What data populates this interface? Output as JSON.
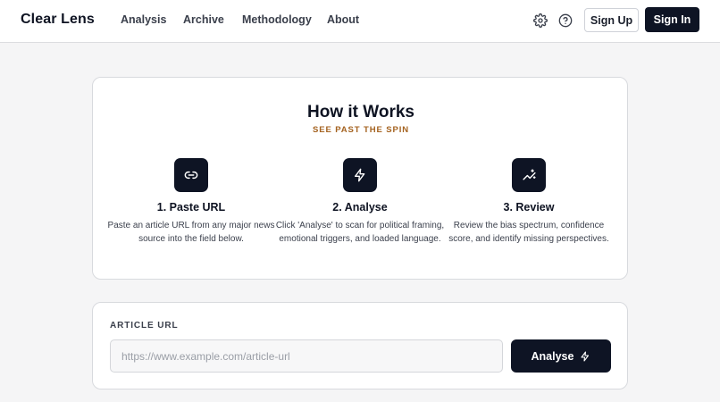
{
  "brand": "Clear Lens",
  "nav": {
    "links": [
      "Analysis",
      "Archive",
      "Methodology",
      "About"
    ],
    "sign_up": "Sign Up",
    "sign_in": "Sign In",
    "icons": [
      "gear-icon",
      "help-icon"
    ]
  },
  "how": {
    "title": "How it Works",
    "subtitle": "SEE PAST THE SPIN",
    "steps": [
      {
        "icon": "link-icon",
        "title": "1. Paste URL",
        "desc": "Paste an article URL from any major news source into the field below."
      },
      {
        "icon": "bolt-icon",
        "title": "2. Analyse",
        "desc": "Click 'Analyse' to scan for political framing, emotional triggers, and loaded language."
      },
      {
        "icon": "sparkle-chart-icon",
        "title": "3. Review",
        "desc": "Review the bias spectrum, confidence score, and identify missing perspectives."
      }
    ]
  },
  "url_form": {
    "label": "ARTICLE URL",
    "placeholder": "https://www.example.com/article-url",
    "value": "",
    "button": "Analyse"
  },
  "colors": {
    "accent_dark": "#0e1424",
    "subtitle": "#a4621f",
    "background": "#f5f5f6"
  }
}
